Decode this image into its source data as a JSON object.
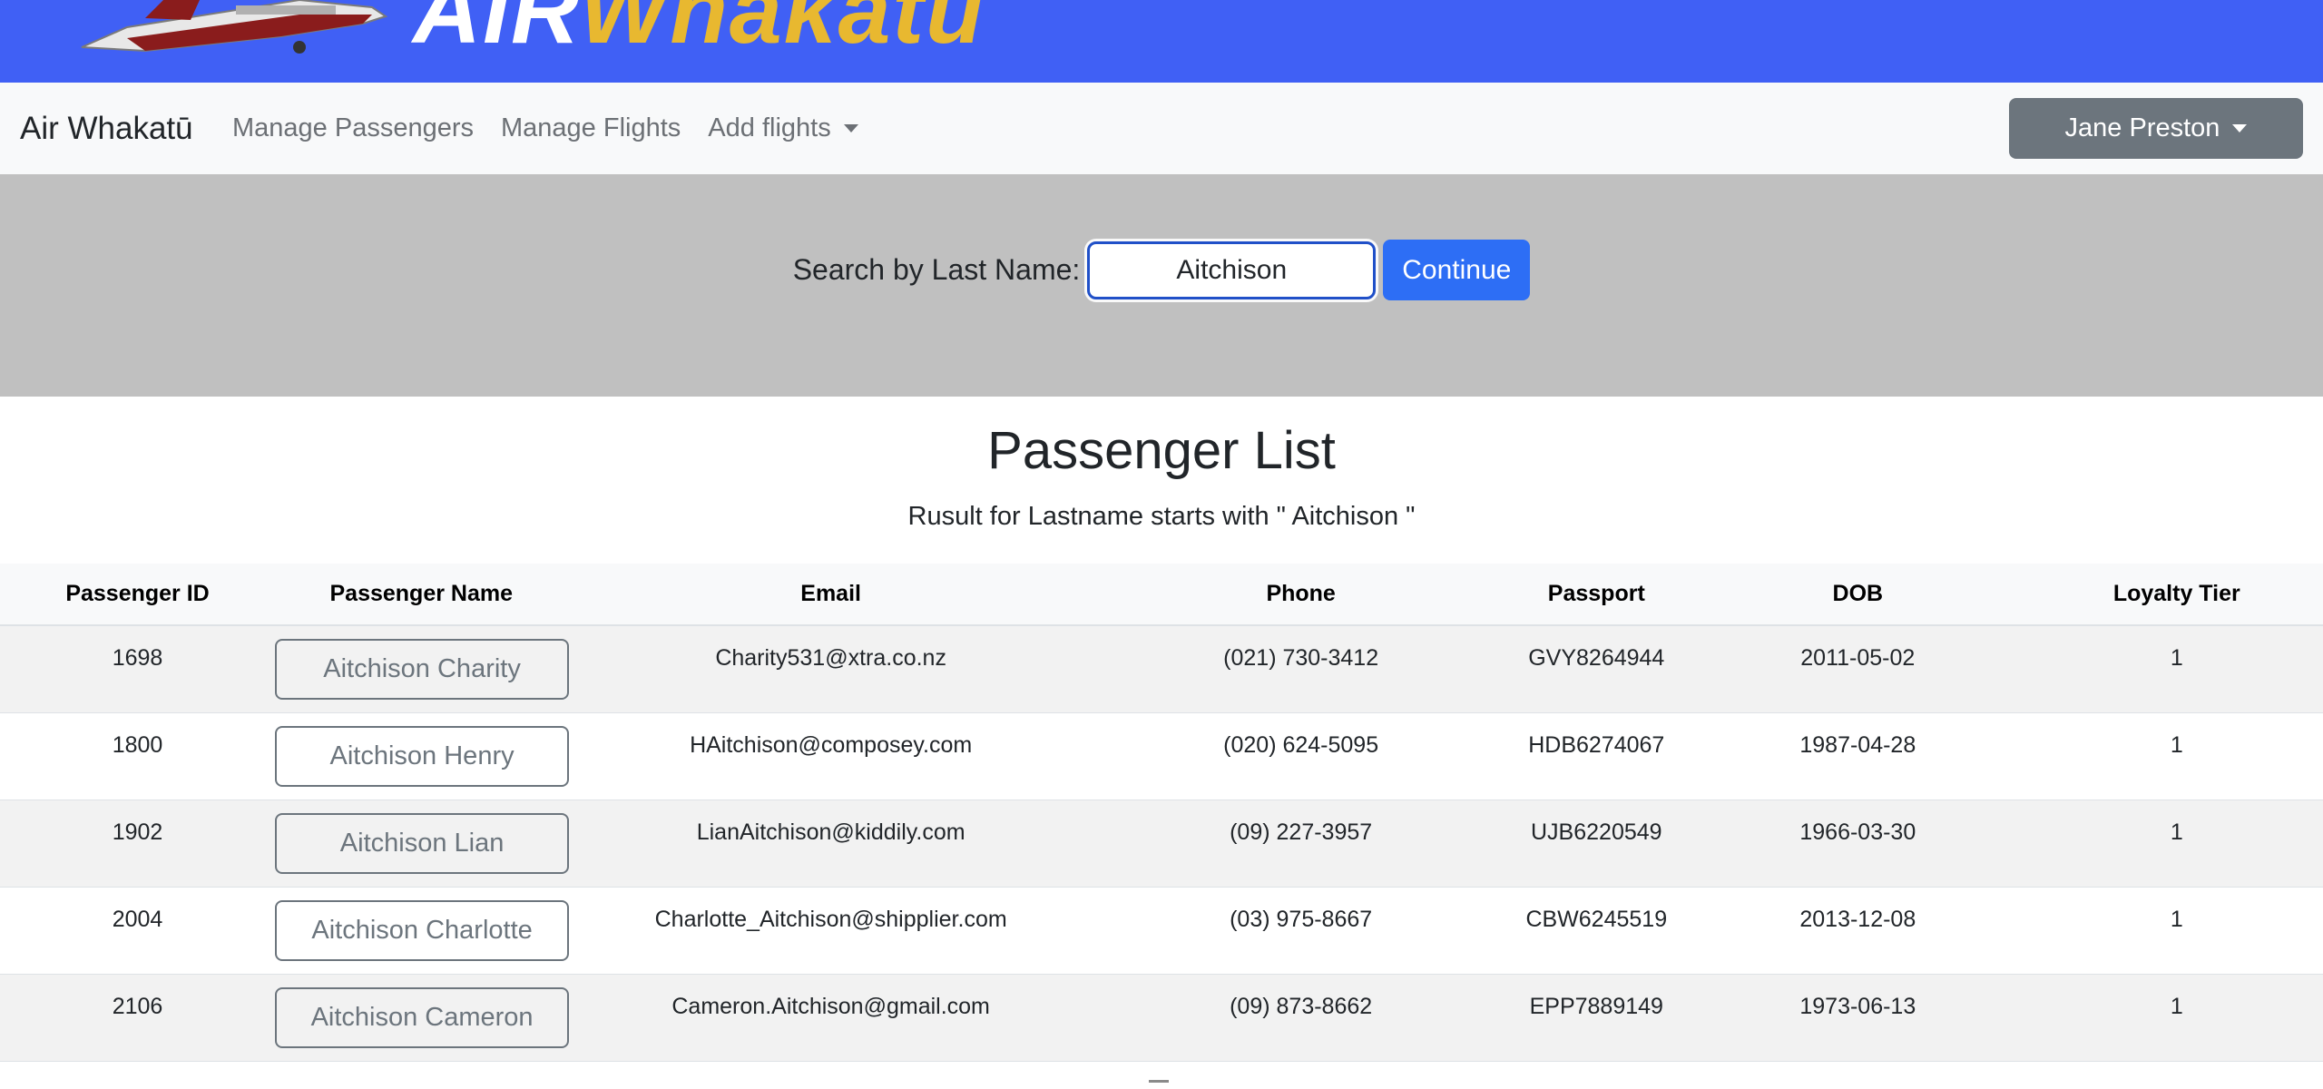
{
  "banner": {
    "brand_part1": "AIR",
    "brand_part2": "Whakatū"
  },
  "navbar": {
    "brand": "Air Whakatū",
    "links": [
      "Manage Passengers",
      "Manage Flights",
      "Add flights"
    ],
    "user": "Jane Preston"
  },
  "search": {
    "label": "Search by Last Name:",
    "value": "Aitchison",
    "button": "Continue"
  },
  "page": {
    "title": "Passenger List",
    "result_text": "Rusult for Lastname starts with \" Aitchison \""
  },
  "table": {
    "headers": [
      "Passenger ID",
      "Passenger Name",
      "Email",
      "Phone",
      "Passport",
      "DOB",
      "Loyalty Tier"
    ],
    "rows": [
      {
        "id": "1698",
        "name": "Aitchison Charity",
        "email": "Charity531@xtra.co.nz",
        "phone": "(021) 730-3412",
        "passport": "GVY8264944",
        "dob": "2011-05-02",
        "tier": "1"
      },
      {
        "id": "1800",
        "name": "Aitchison Henry",
        "email": "HAitchison@composey.com",
        "phone": "(020) 624-5095",
        "passport": "HDB6274067",
        "dob": "1987-04-28",
        "tier": "1"
      },
      {
        "id": "1902",
        "name": "Aitchison Lian",
        "email": "LianAitchison@kiddily.com",
        "phone": "(09) 227-3957",
        "passport": "UJB6220549",
        "dob": "1966-03-30",
        "tier": "1"
      },
      {
        "id": "2004",
        "name": "Aitchison Charlotte",
        "email": "Charlotte_Aitchison@shipplier.com",
        "phone": "(03) 975-8667",
        "passport": "CBW6245519",
        "dob": "2013-12-08",
        "tier": "1"
      },
      {
        "id": "2106",
        "name": "Aitchison Cameron",
        "email": "Cameron.Aitchison@gmail.com",
        "phone": "(09) 873-8662",
        "passport": "EPP7889149",
        "dob": "1973-06-13",
        "tier": "1"
      }
    ]
  },
  "colors": {
    "banner": "#4060f5",
    "brand_accent": "#e8b830",
    "primary_button": "#2d6ef5",
    "user_button": "#6c757d",
    "search_band": "#c0c0c0"
  }
}
